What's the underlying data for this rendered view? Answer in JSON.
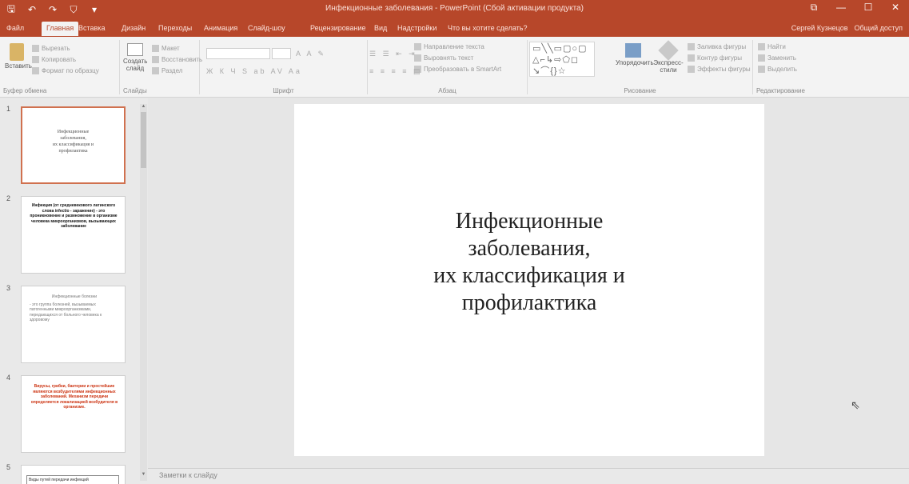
{
  "titlebar": {
    "title": "Инфекционные заболевания - PowerPoint (Сбой активации продукта)",
    "qat": {
      "save": "🖫",
      "undo": "↶",
      "redo": "↷",
      "present": "⛉",
      "more": "▾"
    },
    "win": {
      "restore": "⧉",
      "minimize": "—",
      "maximize": "☐",
      "close": "✕"
    }
  },
  "tabs": {
    "items": [
      "Файл",
      "Главная",
      "Вставка",
      "Дизайн",
      "Переходы",
      "Анимация",
      "Слайд-шоу",
      "Рецензирование",
      "Вид",
      "Надстройки",
      "Что вы хотите сделать?"
    ],
    "active": "Главная",
    "account": "Сергей Кузнецов",
    "share": "Общий доступ"
  },
  "ribbon": {
    "clipboard": {
      "label": "Буфер обмена",
      "paste": "Вставить",
      "cut": "Вырезать",
      "copy": "Копировать",
      "painter": "Формат по образцу"
    },
    "slides": {
      "label": "Слайды",
      "new": "Создать слайд",
      "layout": "Макет",
      "reset": "Восстановить",
      "section": "Раздел"
    },
    "font": {
      "label": "Шрифт",
      "size": ""
    },
    "paragraph": {
      "label": "Абзац",
      "direction": "Направление текста",
      "align": "Выровнять текст",
      "smartart": "Преобразовать в SmartArt"
    },
    "drawing": {
      "label": "Рисование",
      "arrange": "Упорядочить",
      "styles": "Экспресс-стили",
      "fill": "Заливка фигуры",
      "outline": "Контур фигуры",
      "effects": "Эффекты фигуры"
    },
    "editing": {
      "label": "Редактирование",
      "find": "Найти",
      "replace": "Заменить",
      "select": "Выделить"
    },
    "shapes_glyphs": "▭╲╲▭▢○▢\n△⌐↳⇨⬠◻\n↘⌒{}☆"
  },
  "thumbnails": [
    {
      "num": "1",
      "lines": [
        "Инфекционные",
        "заболевания,",
        "их классификация и",
        "профилактика"
      ]
    },
    {
      "num": "2",
      "text": "Инфекция (от средневекового латинского слова infectio - заражение) - это проникновение и размножение в организме человека микроорганизмов, вызывающих заболевание"
    },
    {
      "num": "3",
      "heading": "Инфекционные болезни",
      "text": "- это группа болезней, вызываемых патогенными микроорганизмами, передающихся от больного человека к здоровому"
    },
    {
      "num": "4",
      "text": "Вирусы, грибки, бактерии и простейшие являются возбудителями инфекционных заболеваний. Механизм передачи определяется локализацией возбудителя в организме."
    },
    {
      "num": "5",
      "text": "Виды путей передачи инфекций"
    }
  ],
  "slide": {
    "title_lines": [
      "Инфекционные",
      "заболевания,",
      "их классификация и",
      "профилактика"
    ]
  },
  "notes": {
    "placeholder": "Заметки к слайду"
  },
  "cursor": "⇖",
  "colors": {
    "accent": "#b7472a",
    "ribbon": "#f3f3f3",
    "canvas": "#e6e6e6"
  }
}
